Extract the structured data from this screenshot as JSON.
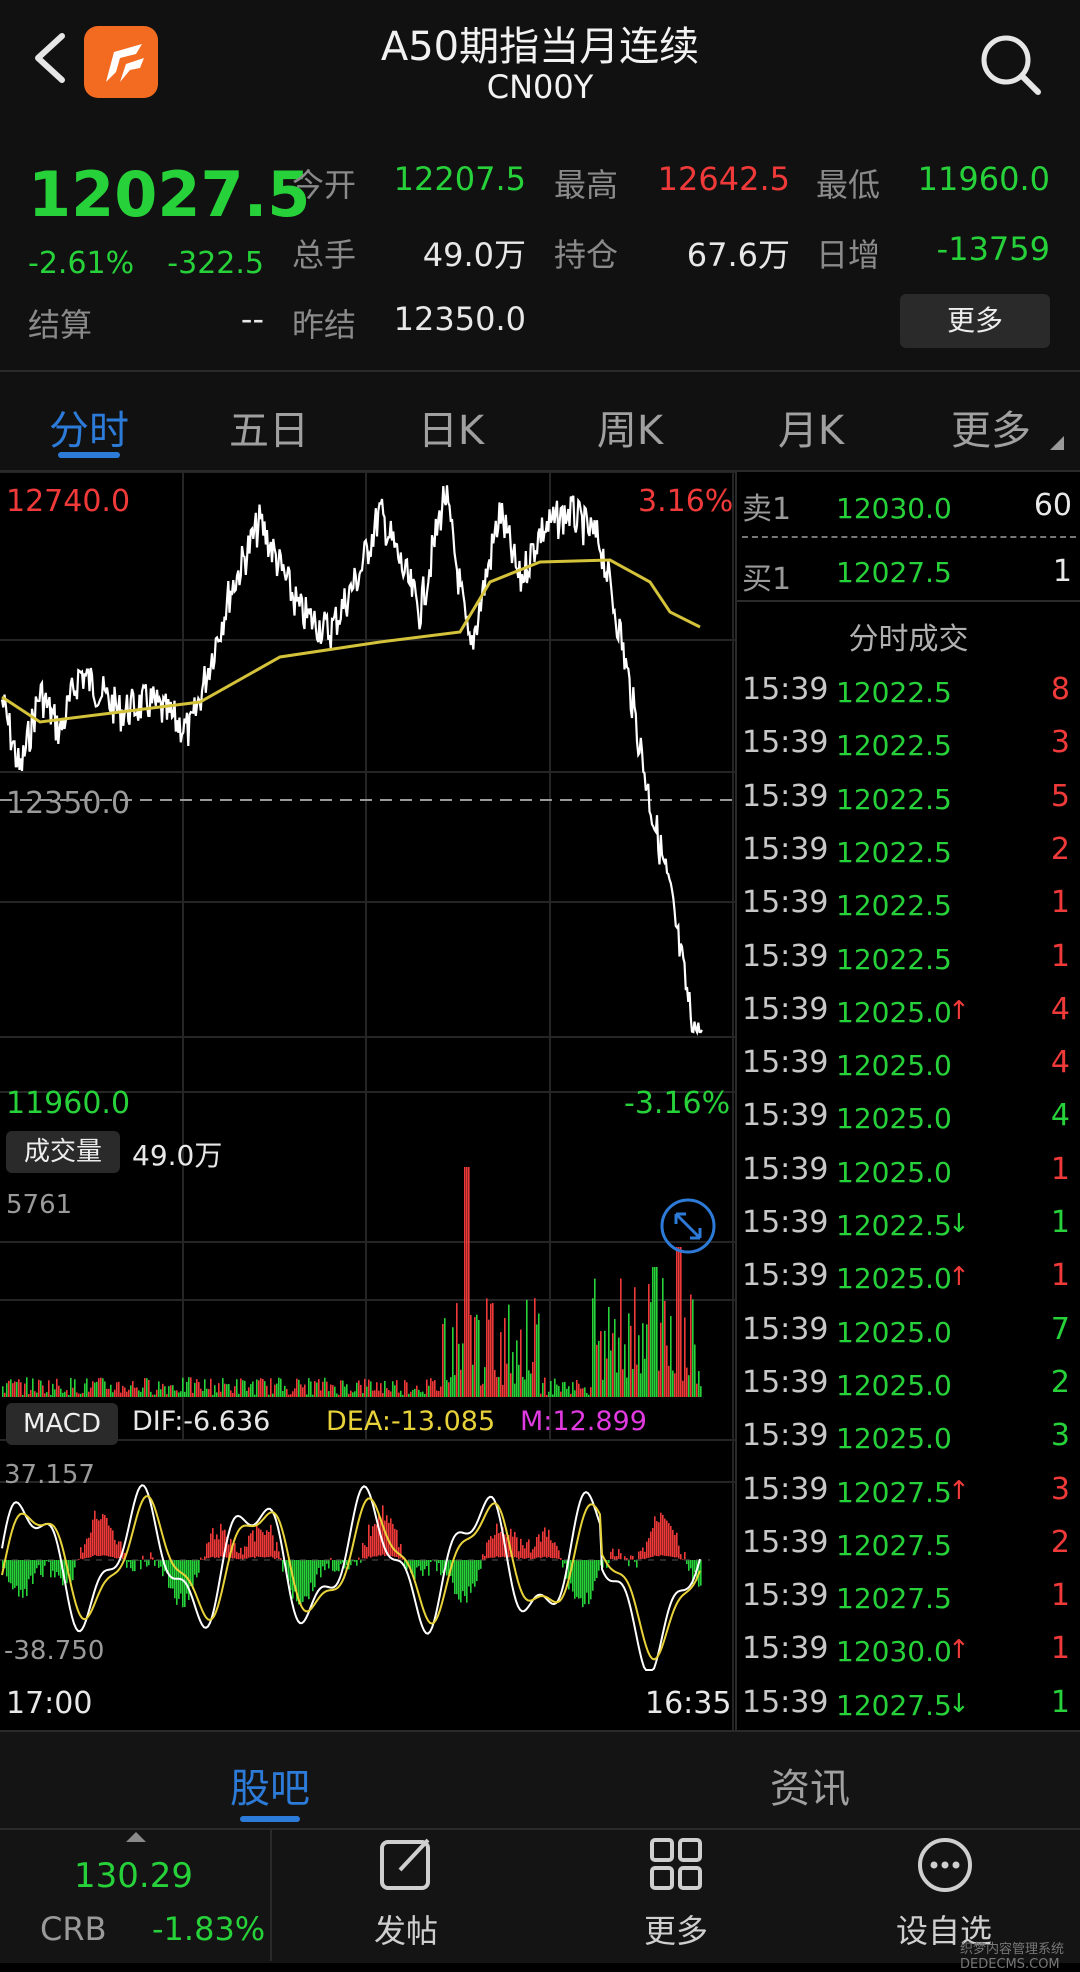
{
  "header": {
    "title": "A50期指当月连续",
    "subtitle": "CN00Y"
  },
  "quote": {
    "price": "12027.5",
    "pct": "-2.61%",
    "change": "-322.5",
    "open_label": "今开",
    "open": "12207.5",
    "high_label": "最高",
    "high": "12642.5",
    "low_label": "最低",
    "low": "11960.0",
    "volume_label": "总手",
    "volume": "49.0万",
    "oi_label": "持仓",
    "oi": "67.6万",
    "daily_inc_label": "日增",
    "daily_inc": "-13759",
    "settle_label": "结算",
    "settle": "--",
    "prev_settle_label": "昨结",
    "prev_settle": "12350.0",
    "more_button": "更多"
  },
  "tabs": [
    "分时",
    "五日",
    "日K",
    "周K",
    "月K",
    "更多"
  ],
  "chart": {
    "top_price": "12740.0",
    "top_pct": "3.16%",
    "mid_price": "12350.0",
    "bottom_price": "11960.0",
    "bottom_pct": "-3.16%",
    "volume_tag": "成交量",
    "volume_value": "49.0万",
    "volume_max": "5761",
    "macd_tag": "MACD",
    "dif": "DIF:-6.636",
    "dea": "DEA:-13.085",
    "m": "M:12.899",
    "macd_top": "37.157",
    "macd_bottom": "-38.750",
    "time_start": "17:00",
    "time_end": "16:35",
    "colors": {
      "price_line": "#ffffff",
      "avg_line": "#d4c33a",
      "up": "#f03a3a",
      "down": "#27d13a",
      "dea": "#e8d23a",
      "m": "#e03ae0"
    }
  },
  "orderbook": {
    "sell_label": "卖1",
    "sell_price": "12030.0",
    "sell_vol": "60",
    "buy_label": "买1",
    "buy_price": "12027.5",
    "buy_vol": "1",
    "trades_title": "分时成交"
  },
  "trades": [
    {
      "t": "15:39",
      "p": "12022.5",
      "v": "8",
      "vc": "r",
      "a": ""
    },
    {
      "t": "15:39",
      "p": "12022.5",
      "v": "3",
      "vc": "r",
      "a": ""
    },
    {
      "t": "15:39",
      "p": "12022.5",
      "v": "5",
      "vc": "r",
      "a": ""
    },
    {
      "t": "15:39",
      "p": "12022.5",
      "v": "2",
      "vc": "r",
      "a": ""
    },
    {
      "t": "15:39",
      "p": "12022.5",
      "v": "1",
      "vc": "r",
      "a": ""
    },
    {
      "t": "15:39",
      "p": "12022.5",
      "v": "1",
      "vc": "r",
      "a": ""
    },
    {
      "t": "15:39",
      "p": "12025.0",
      "v": "4",
      "vc": "r",
      "a": "↑"
    },
    {
      "t": "15:39",
      "p": "12025.0",
      "v": "4",
      "vc": "r",
      "a": ""
    },
    {
      "t": "15:39",
      "p": "12025.0",
      "v": "4",
      "vc": "g",
      "a": ""
    },
    {
      "t": "15:39",
      "p": "12025.0",
      "v": "1",
      "vc": "r",
      "a": ""
    },
    {
      "t": "15:39",
      "p": "12022.5",
      "v": "1",
      "vc": "g",
      "a": "↓"
    },
    {
      "t": "15:39",
      "p": "12025.0",
      "v": "1",
      "vc": "r",
      "a": "↑"
    },
    {
      "t": "15:39",
      "p": "12025.0",
      "v": "7",
      "vc": "g",
      "a": ""
    },
    {
      "t": "15:39",
      "p": "12025.0",
      "v": "2",
      "vc": "g",
      "a": ""
    },
    {
      "t": "15:39",
      "p": "12025.0",
      "v": "3",
      "vc": "g",
      "a": ""
    },
    {
      "t": "15:39",
      "p": "12027.5",
      "v": "3",
      "vc": "r",
      "a": "↑"
    },
    {
      "t": "15:39",
      "p": "12027.5",
      "v": "2",
      "vc": "r",
      "a": ""
    },
    {
      "t": "15:39",
      "p": "12027.5",
      "v": "1",
      "vc": "r",
      "a": ""
    },
    {
      "t": "15:39",
      "p": "12030.0",
      "v": "1",
      "vc": "r",
      "a": "↑"
    },
    {
      "t": "15:39",
      "p": "12027.5",
      "v": "1",
      "vc": "g",
      "a": "↓"
    }
  ],
  "bottom_tabs": [
    "股吧",
    "资讯"
  ],
  "nav": {
    "ticker_value": "130.29",
    "ticker_name": "CRB",
    "ticker_pct": "-1.83%",
    "items": [
      "发帖",
      "更多",
      "设自选"
    ]
  },
  "watermark": "织梦内容管理系统 DEDECMS.COM"
}
